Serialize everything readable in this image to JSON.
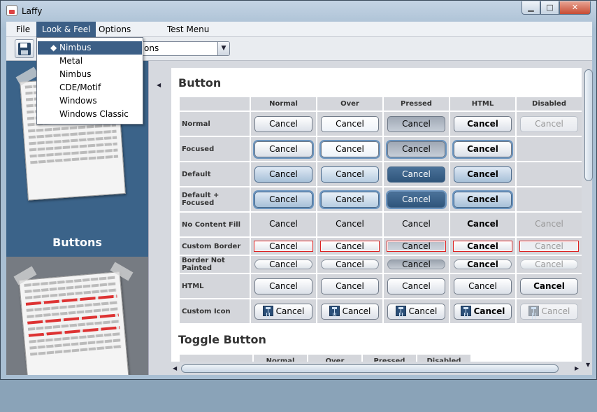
{
  "window": {
    "title": "Laffy",
    "min_glyph": "▁",
    "max_glyph": "□",
    "close_glyph": "✕"
  },
  "menubar": {
    "items": [
      "File",
      "Look & Feel",
      "Options",
      "Test Menu"
    ]
  },
  "dropdown": {
    "items": [
      "◆ Nimbus",
      "Metal",
      "Nimbus",
      "CDE/Motif",
      "Windows",
      "Windows Classic"
    ]
  },
  "toolbar": {
    "combo_value": "ons",
    "combo_arrow": "▼"
  },
  "sidebar": {
    "items": [
      {
        "label": "Buttons"
      },
      {
        "label": ""
      }
    ]
  },
  "splitter": {
    "arrow": "◀"
  },
  "content": {
    "section1": {
      "title": "Button",
      "columns": [
        "Normal",
        "Over",
        "Pressed",
        "HTML",
        "Disabled"
      ],
      "rows": [
        {
          "label": "Normal",
          "cells": [
            "Cancel",
            "Cancel",
            "Cancel",
            "Cancel",
            "Cancel"
          ]
        },
        {
          "label": "Focused",
          "cells": [
            "Cancel",
            "Cancel",
            "Cancel",
            "Cancel",
            ""
          ]
        },
        {
          "label": "Default",
          "cells": [
            "Cancel",
            "Cancel",
            "Cancel",
            "Cancel",
            ""
          ]
        },
        {
          "label": "Default + Focused",
          "cells": [
            "Cancel",
            "Cancel",
            "Cancel",
            "Cancel",
            ""
          ]
        },
        {
          "label": "No Content Fill",
          "cells": [
            "Cancel",
            "Cancel",
            "Cancel",
            "Cancel",
            "Cancel"
          ]
        },
        {
          "label": "Custom Border",
          "cells": [
            "Cancel",
            "Cancel",
            "Cancel",
            "Cancel",
            "Cancel"
          ]
        },
        {
          "label": "Border Not Painted",
          "cells": [
            "Cancel",
            "Cancel",
            "Cancel",
            "Cancel",
            "Cancel"
          ]
        },
        {
          "label": "HTML",
          "cells": [
            "Cancel",
            "Cancel",
            "Cancel",
            "Cancel",
            "Cancel"
          ]
        },
        {
          "label": "Custom Icon",
          "cells": [
            "Cancel",
            "Cancel",
            "Cancel",
            "Cancel",
            "Cancel"
          ]
        }
      ]
    },
    "section2": {
      "title": "Toggle Button",
      "columns": [
        "Normal",
        "Over",
        "Pressed",
        "Disabled"
      ]
    }
  },
  "scroll": {
    "up": "▲",
    "down": "▼",
    "left": "◀",
    "right": "▶"
  }
}
